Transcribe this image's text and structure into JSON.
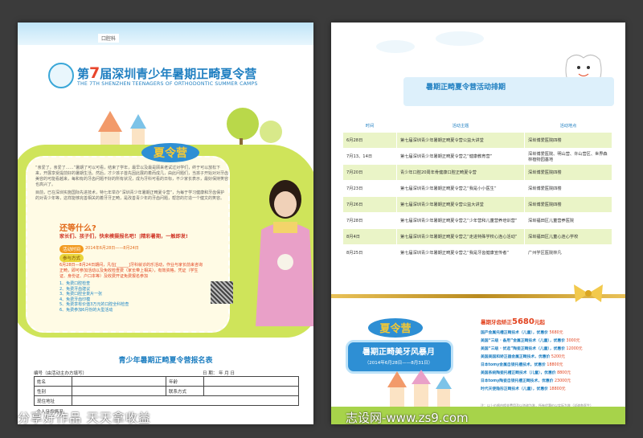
{
  "left": {
    "clinic": "口腔科",
    "title_num": "7",
    "title_pre": "第",
    "title_rest": "届深圳青少年暑期正畸夏令营",
    "subtitle": "THE 7TH SHENZHEN TEENAGERS OF ORTHODONTIC SUMMER CAMPS",
    "body_1": "“亲爱了，亲爱了……”暑期了可以可看，结束了学年，最早以及最是顾来老试过对学们，终于可以放松下来，开展享受提前好的暑期生活。然后，才少孩子首先因此展的着而成几，由此问题们，当孩子开始对对牙齿美容的可能看越来，每和有的牙齿问题不好的所有状况，成为牙科可看的日标，不少家长表示，最好保持笑容也高兴了。",
    "body_2": "目前，已在深圳实施国际先进技术，特七年举办“深圳青少年暑期正畸夏令营”，为每于学习健康和牙齿保护的对青少年等，这样能够完善相关的着牙牙正畸，是改善青少年的牙齿问题，帮您的打造一个健文的笑容。",
    "q_title": "还等什么?",
    "q_line": "家长们、孩子们，快来模摄报名吧！|精彩暑期，一触即发!",
    "time_label": "活动时间",
    "time_value": "2014年6月28日——8月24日",
    "way_label": "参与方式",
    "way_text": "6月28日—8月24日期间，凡在[______]牙科就诊的乐活动，作业与家长前来咨询正畸，即可参加活动以及免收检查费（家长带上相关），有效资格，凭证（学生证、身份证、户口本等）及收费开证免费报名参加",
    "list": [
      "1、免费口腔检查",
      "2、免费牙齿建议",
      "3、免费口腔全景片一张",
      "4、免费牙齿印模",
      "5、免费享有价值3万元的口腔全科检查",
      "6、免费参加6月份的大型活动"
    ],
    "form_title": "青少年暑期正畸夏令营报名表",
    "form_no": "编号（由活动主办方填写）",
    "form_date": "日  期：     年    月    日",
    "form_name": "姓名",
    "form_age": "年龄",
    "form_gender": "性别",
    "form_phone": "联系方式",
    "form_addr": "现住地址",
    "form_teeth": "个人牙齿情况:",
    "slogan": "分享好作品 天天拿收益"
  },
  "right": {
    "title": "暑期正畸夏令营活动排期",
    "head": [
      "时间",
      "活动主题",
      "活动地点"
    ],
    "rows": [
      [
        "6月28日",
        "第七届深圳青少年暑期正畸夏令营公益大讲堂",
        "深圳博爱医院四楼"
      ],
      [
        "7月13、14日",
        "第七届深圳青少年暑期正畸夏令营之“健康教育营”",
        "深圳博爱医院、明山营、许山营区、世界森林植物园基地"
      ],
      [
        "7月20日",
        "青少年口腔20周年骨健康口腔正畸夏令营",
        "深圳博爱医院四楼"
      ],
      [
        "7月23日",
        "第七届深圳青少年暑期正畸夏令营之“我是小小医生”",
        "深圳博爱医院四楼"
      ],
      [
        "7月26日",
        "第七届深圳青少年暑期正畸夏令营公益大讲堂",
        "深圳博爱医院四楼"
      ],
      [
        "7月28日",
        "第七届深圳青少年暑期正畸夏令营之“少年营和儿童营养培训营”",
        "深圳福田区儿童营养医院"
      ],
      [
        "8月4日",
        "第七届深圳青少年暑期正畸夏令营之“走进特殊学校心连心活动”",
        "深圳福田区儿童心连心学校"
      ],
      [
        "8月25日",
        "第七届深圳青少年暑期正畸夏令营之“我是牙齿健康宣传者”",
        "广州学区医院林凡"
      ]
    ],
    "promo_title": "暑期正畸美牙风暴月",
    "promo_date": "（2014年6月28日——8月31日）",
    "price_pre": "暑期牙齿矫正",
    "price_big": "5680",
    "price_post": "元起",
    "prices": [
      [
        "国产金属托槽正畸技术（儿童），优惠价",
        "5680元"
      ],
      [
        "美国“三级 · 备用”金属正畸技术（儿童），优惠价",
        "3000元"
      ],
      [
        "美国“三级 · 优选”陶瓷正畸技术（儿童），优惠价",
        "12000元"
      ],
      [
        "美国美国和矫正器金属正畸技术，优惠价",
        "5200元"
      ],
      [
        "日本tomy金属自锁托槽技术，优惠价",
        "18800元"
      ],
      [
        "美国系统陶瓷托槽正畸技术（儿童），优惠价",
        "8800元"
      ],
      [
        "日本tomy陶瓷自锁托槽正畸技术，优惠价",
        "23000元"
      ],
      [
        "时代天使隐形正畸技术（儿童），优惠价",
        "18800元"
      ]
    ],
    "price_note": "注：以上价格由相关费用及以咨询为准，所有优惠价以实际为准（详询各医生）",
    "watermark": "志设网-www.zs9.com"
  }
}
